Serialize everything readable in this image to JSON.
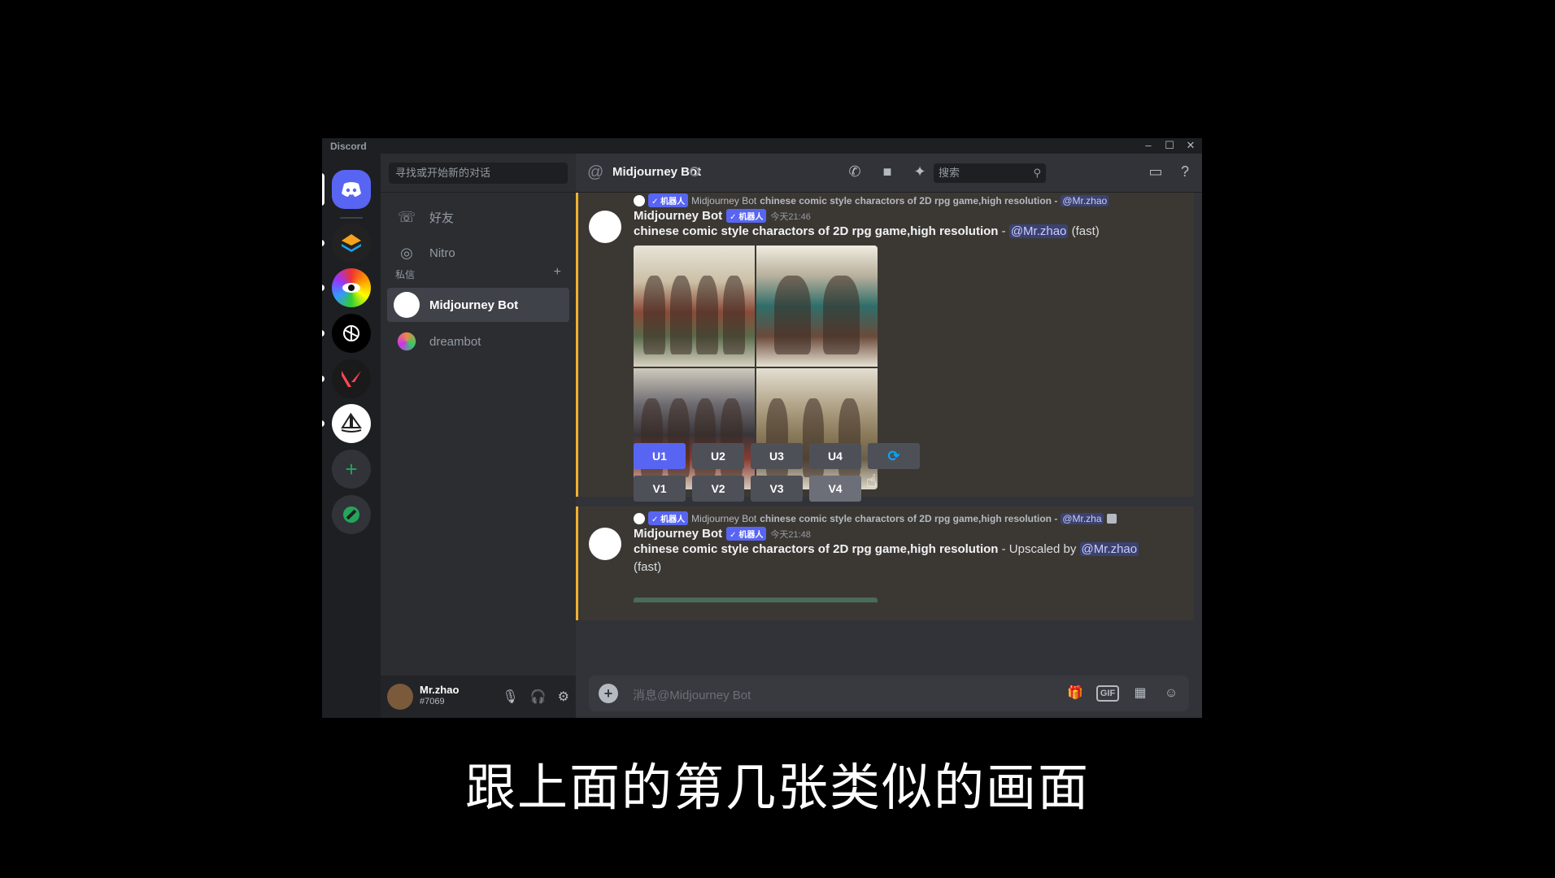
{
  "app": {
    "title": "Discord"
  },
  "window_controls": [
    "–",
    "☐",
    "✕"
  ],
  "sidebar": {
    "search_placeholder": "寻找或开始新的对话",
    "nav": [
      {
        "label": "好友",
        "icon": "friends-icon"
      },
      {
        "label": "Nitro",
        "icon": "nitro-icon"
      }
    ],
    "dm_header": "私信",
    "dms": [
      {
        "name": "Midjourney Bot",
        "active": true
      },
      {
        "name": "dreambot",
        "active": false
      }
    ],
    "user": {
      "name": "Mr.zhao",
      "tag": "#7069"
    }
  },
  "header": {
    "title": "Midjourney Bot",
    "search_placeholder": "搜索"
  },
  "messages": [
    {
      "reply": {
        "badge": "✓ 机器人",
        "author": "Midjourney Bot",
        "text": "chinese comic style charactors of 2D rpg game,high resolution -",
        "mention": "@Mr.zhao"
      },
      "author": "Midjourney Bot",
      "badge": "✓ 机器人",
      "time": "今天21:46",
      "prompt": "chinese comic style charactors of 2D rpg game,high resolution",
      "sep": " - ",
      "mention": "@Mr.zhao",
      "suffix": " (fast)",
      "buttons_u": [
        "U1",
        "U2",
        "U3",
        "U4"
      ],
      "buttons_v": [
        "V1",
        "V2",
        "V3",
        "V4"
      ]
    },
    {
      "reply": {
        "badge": "✓ 机器人",
        "author": "Midjourney Bot",
        "text": "chinese comic style charactors of 2D rpg game,high resolution -",
        "mention": "@Mr.zha"
      },
      "author": "Midjourney Bot",
      "badge": "✓ 机器人",
      "time": "今天21:48",
      "prompt": "chinese comic style charactors of 2D rpg game,high resolution",
      "sep": " - Upscaled by ",
      "mention": "@Mr.zhao",
      "suffix": "(fast)"
    }
  ],
  "composer": {
    "placeholder": "消息@Midjourney Bot",
    "gif_label": "GIF"
  },
  "subtitle": "跟上面的第几张类似的画面",
  "colors": {
    "accent": "#5865f2",
    "highlight_border": "#f0b232"
  }
}
